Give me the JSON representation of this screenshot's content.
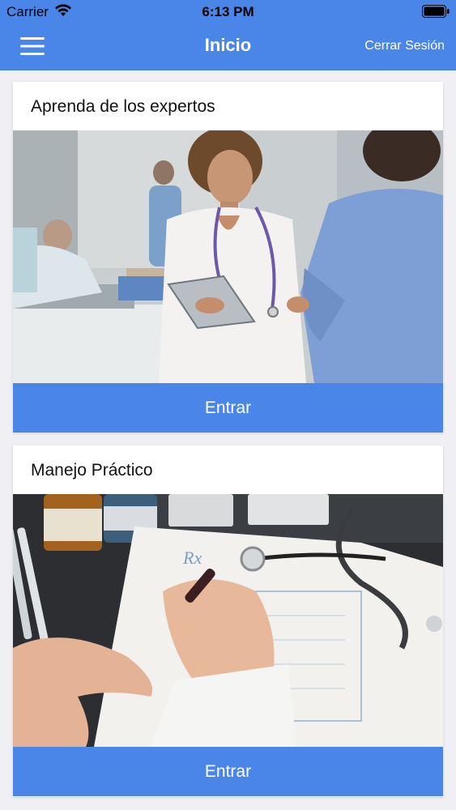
{
  "status_bar": {
    "carrier": "Carrier",
    "time": "6:13 PM",
    "wifi_icon": "wifi-icon",
    "battery_icon": "battery-icon"
  },
  "nav": {
    "menu_icon": "hamburger-menu-icon",
    "title": "Inicio",
    "logout_label": "Cerrar Sesión"
  },
  "colors": {
    "brand_blue": "#4a86e8",
    "background": "#efeff4",
    "card": "#ffffff"
  },
  "cards": [
    {
      "title": "Aprenda de los expertos",
      "image": "photo of a doctor with stethoscope holding a tablet in a hospital ward",
      "button_label": "Entrar"
    },
    {
      "title": "Manejo Práctico",
      "image": "photo of a doctor writing a prescription with stethoscope and pills on desk",
      "button_label": "Entrar"
    }
  ]
}
